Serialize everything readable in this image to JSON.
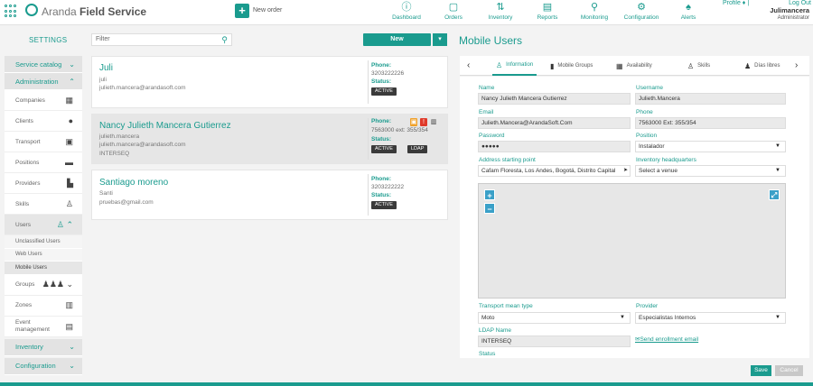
{
  "header": {
    "brand_prefix": "Aranda",
    "brand_suffix": "Field Service",
    "new_order_label": "New order",
    "nav": [
      {
        "label": "Dashboard",
        "icon": "dashboard-icon"
      },
      {
        "label": "Orders",
        "icon": "orders-icon"
      },
      {
        "label": "Inventory",
        "icon": "inventory-icon"
      },
      {
        "label": "Reports",
        "icon": "reports-icon"
      },
      {
        "label": "Monitoring",
        "icon": "monitoring-icon"
      },
      {
        "label": "Configuration",
        "icon": "gear-icon"
      },
      {
        "label": "Alerts",
        "icon": "bell-icon"
      }
    ],
    "profile_label": "Profile",
    "logout_label": "Log Out",
    "user_name": "Julimancera",
    "user_role": "Administrator"
  },
  "sidebar": {
    "title": "SETTINGS",
    "service_catalog": "Service catalog",
    "administration": "Administration",
    "items": [
      {
        "label": "Companies",
        "icon": "building-icon"
      },
      {
        "label": "Clients",
        "icon": "person-icon"
      },
      {
        "label": "Transport",
        "icon": "bus-icon"
      },
      {
        "label": "Positions",
        "icon": "briefcase-icon"
      },
      {
        "label": "Providers",
        "icon": "truck-icon"
      },
      {
        "label": "Skills",
        "icon": "person-walking-icon"
      }
    ],
    "users": "Users",
    "users_sub": [
      "Unclassified Users",
      "Web Users",
      "Mobile Users"
    ],
    "groups": "Groups",
    "zones": "Zones",
    "event_management_1": "Event",
    "event_management_2": "management",
    "inventory": "Inventory",
    "configuration": "Configuration"
  },
  "list": {
    "filter_placeholder": "Filter",
    "new_label": "New",
    "phone_label": "Phone:",
    "status_label": "Status:",
    "cards": [
      {
        "name": "Juli",
        "username": "juli",
        "email": "julieth.mancera@arandasoft.com",
        "org": "",
        "phone": "3203222226",
        "status": "ACTIVE"
      },
      {
        "name": "Nancy Julieth Mancera Gutierrez",
        "username": "julieth.mancera",
        "email": "julieth.mancera@arandasoft.com",
        "org": "INTERSEQ",
        "phone": "7563000 ext: 355/354",
        "status": "ACTIVE",
        "ldap": "LDAP"
      },
      {
        "name": "Santiago moreno",
        "username": "Santi",
        "email": "pruebas@gmail.com",
        "org": "",
        "phone": "3203222222",
        "status": "ACTIVE"
      }
    ]
  },
  "panel": {
    "title": "Mobile Users",
    "tabs": [
      "Information",
      "Mobile Groups",
      "Availability",
      "Skills",
      "Días libres"
    ],
    "fields": {
      "name_label": "Name",
      "name_value": "Nancy Julieth Mancera Gutierrez",
      "username_label": "Username",
      "username_value": "Julieth.Mancera",
      "email_label": "Email",
      "email_value": "Julieth.Mancera@ArandaSoft.Com",
      "phone_label": "Phone",
      "phone_value": "7563000 Ext: 355/354",
      "password_label": "Password",
      "password_value": "●●●●●",
      "position_label": "Position",
      "position_value": "Instalador",
      "address_label": "Address starting point",
      "address_value": "Cafam Floresta, Los Andes, Bogotá, Distrito Capital",
      "inventory_label": "Inventory headquarters",
      "inventory_value": "Select a venue",
      "transport_label": "Transport mean type",
      "transport_value": "Moto",
      "provider_label": "Provider",
      "provider_value": "Especialistas Internos",
      "ldap_label": "LDAP Name",
      "ldap_value": "INTERSEQ",
      "status_label": "Status",
      "enroll_link": "Send enrollment email"
    },
    "save_label": "Save",
    "cancel_label": "Cancel"
  }
}
